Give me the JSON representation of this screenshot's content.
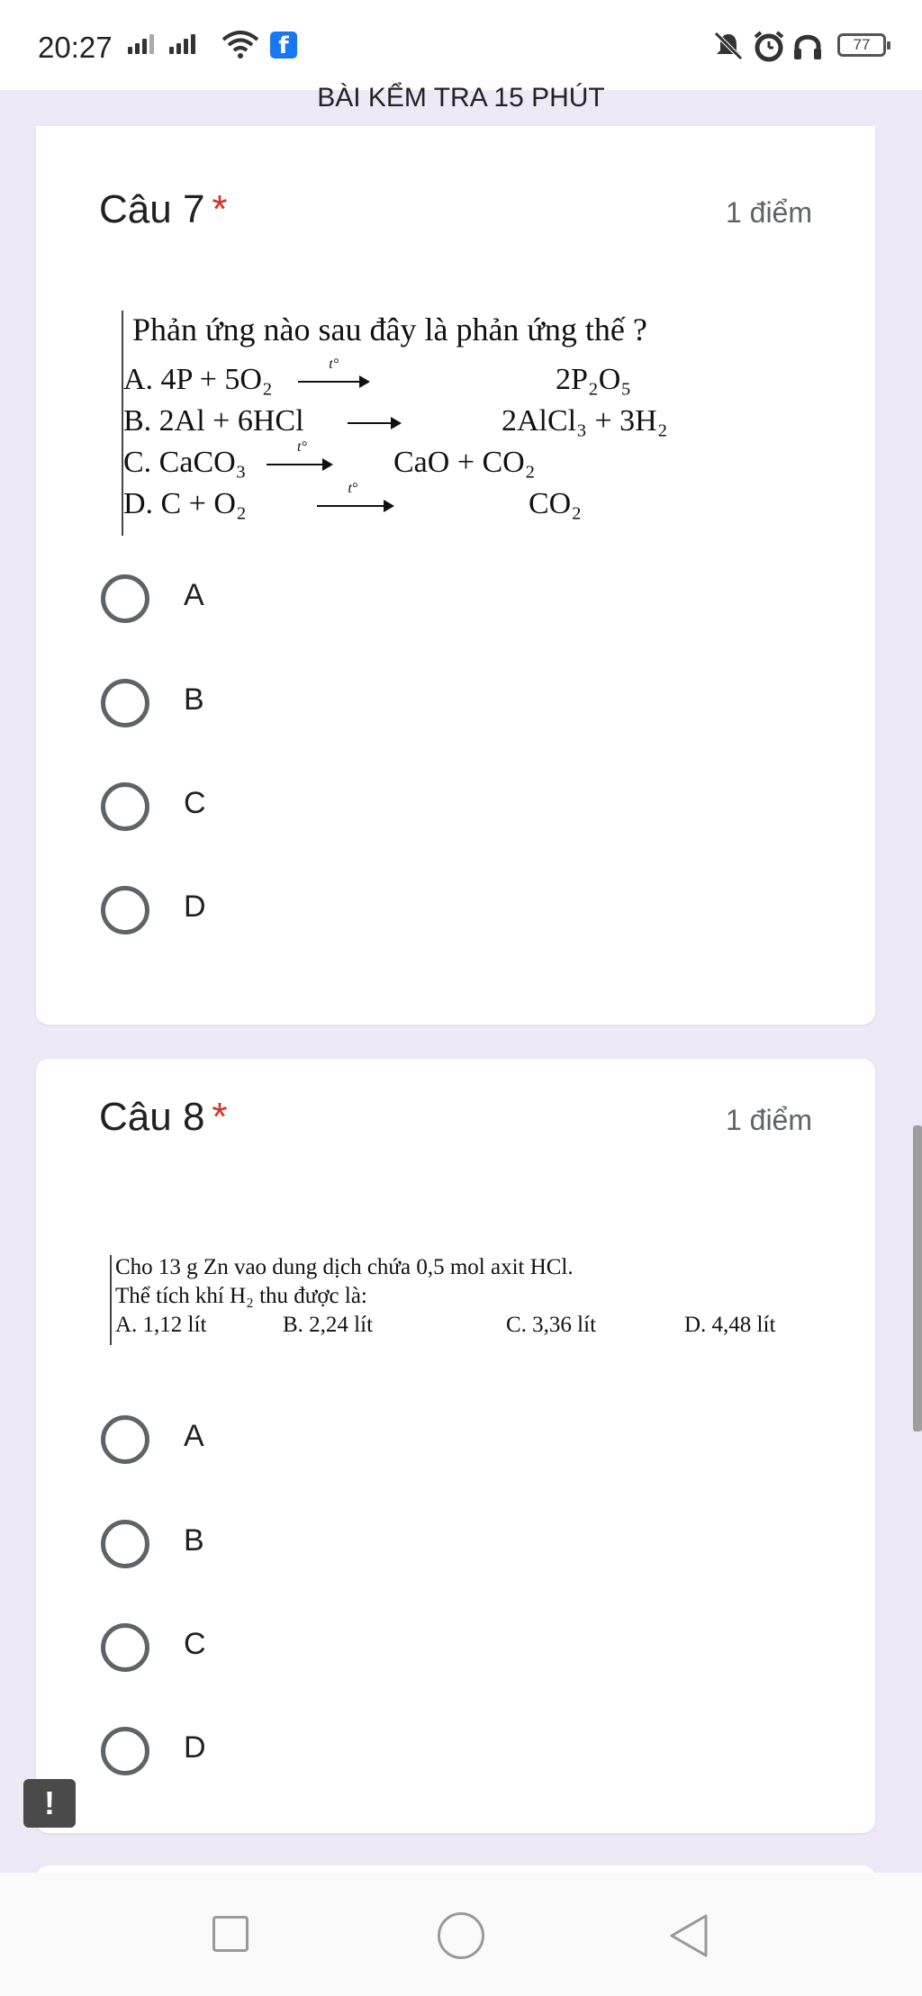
{
  "status_bar": {
    "time": "20:27",
    "battery": "77"
  },
  "header": {
    "title": "BÀI KỂM TRA 15 PHÚT"
  },
  "questions": [
    {
      "title": "Câu 7",
      "required_mark": "*",
      "points": "1 điểm",
      "image_text": {
        "heading": "Phản ứng nào sau đây là phản ứng thế ?",
        "line_a": "A. 4P + 5O₂",
        "line_a_right": "2P₂O₅",
        "line_b": "B. 2Al + 6HCl",
        "line_b_right": "2AlCl₃ + 3H₂",
        "line_c": "C. CaCO₃",
        "line_c_right": "CaO + CO₂",
        "line_d": "D. C + O₂",
        "line_d_right": "CO₂"
      },
      "options": [
        "A",
        "B",
        "C",
        "D"
      ]
    },
    {
      "title": "Câu 8",
      "required_mark": "*",
      "points": "1 điểm",
      "image_text": {
        "line1": "Cho 13 g Zn vao dung dịch chứa 0,5 mol axit HCl.",
        "line2": "Thể tích khí H₂ thu được là:",
        "ans_a": "A. 1,12 lít",
        "ans_b": "B. 2,24 lít",
        "ans_c": "C. 3,36 lít",
        "ans_d": "D. 4,48 lít"
      },
      "options": [
        "A",
        "B",
        "C",
        "D"
      ]
    }
  ],
  "report_button": "!",
  "colors": {
    "background": "#efe9f7",
    "required": "#d93025",
    "radio": "#5f6368"
  },
  "icons": [
    "signal-icon",
    "wifi-icon",
    "facebook-icon",
    "mute-icon",
    "alarm-icon",
    "headset-icon",
    "battery-icon",
    "nav-recents-icon",
    "nav-home-icon",
    "nav-back-icon"
  ]
}
